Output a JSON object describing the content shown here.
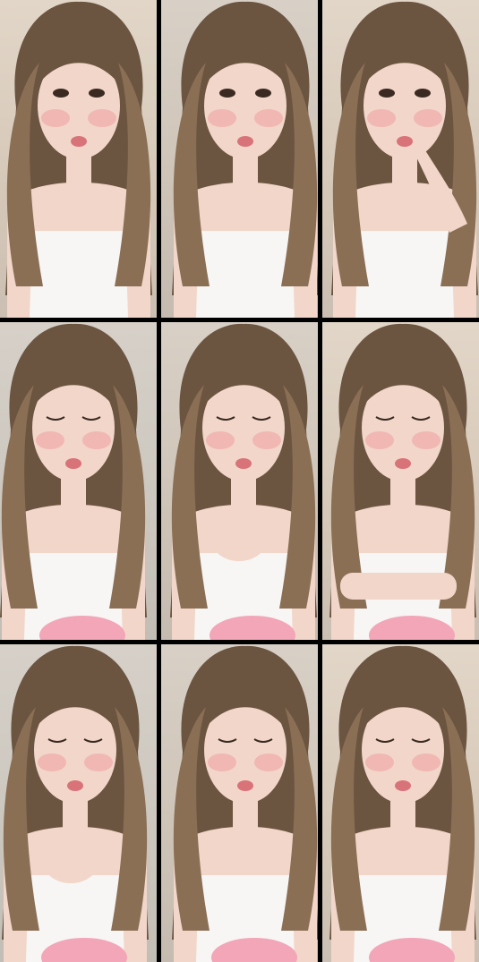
{
  "frames": [
    {
      "id": 1,
      "pose": "looking-at-camera",
      "eyes": "open",
      "hand": "none"
    },
    {
      "id": 2,
      "pose": "looking-at-camera",
      "eyes": "open",
      "hand": "none"
    },
    {
      "id": 3,
      "pose": "finger-to-lips",
      "eyes": "open",
      "hand": "finger-to-lips"
    },
    {
      "id": 4,
      "pose": "eyes-closed",
      "eyes": "closed",
      "hand": "none"
    },
    {
      "id": 5,
      "pose": "hand-on-chest",
      "eyes": "closed",
      "hand": "chest"
    },
    {
      "id": 6,
      "pose": "arm-across-body",
      "eyes": "closed",
      "hand": "arm-across"
    },
    {
      "id": 7,
      "pose": "hand-on-chest",
      "eyes": "closed",
      "hand": "chest"
    },
    {
      "id": 8,
      "pose": "eyes-closed",
      "eyes": "closed",
      "hand": "none"
    },
    {
      "id": 9,
      "pose": "eyes-closed",
      "eyes": "closed",
      "hand": "none"
    }
  ],
  "colors": {
    "hair": "#6b5440",
    "hair_highlight": "#8a6f55",
    "skin": "#f2d6c9",
    "blush": "#ef9ea1",
    "top": "#f7f6f4",
    "pillow": "#f2a6b8",
    "background": "#000000"
  }
}
